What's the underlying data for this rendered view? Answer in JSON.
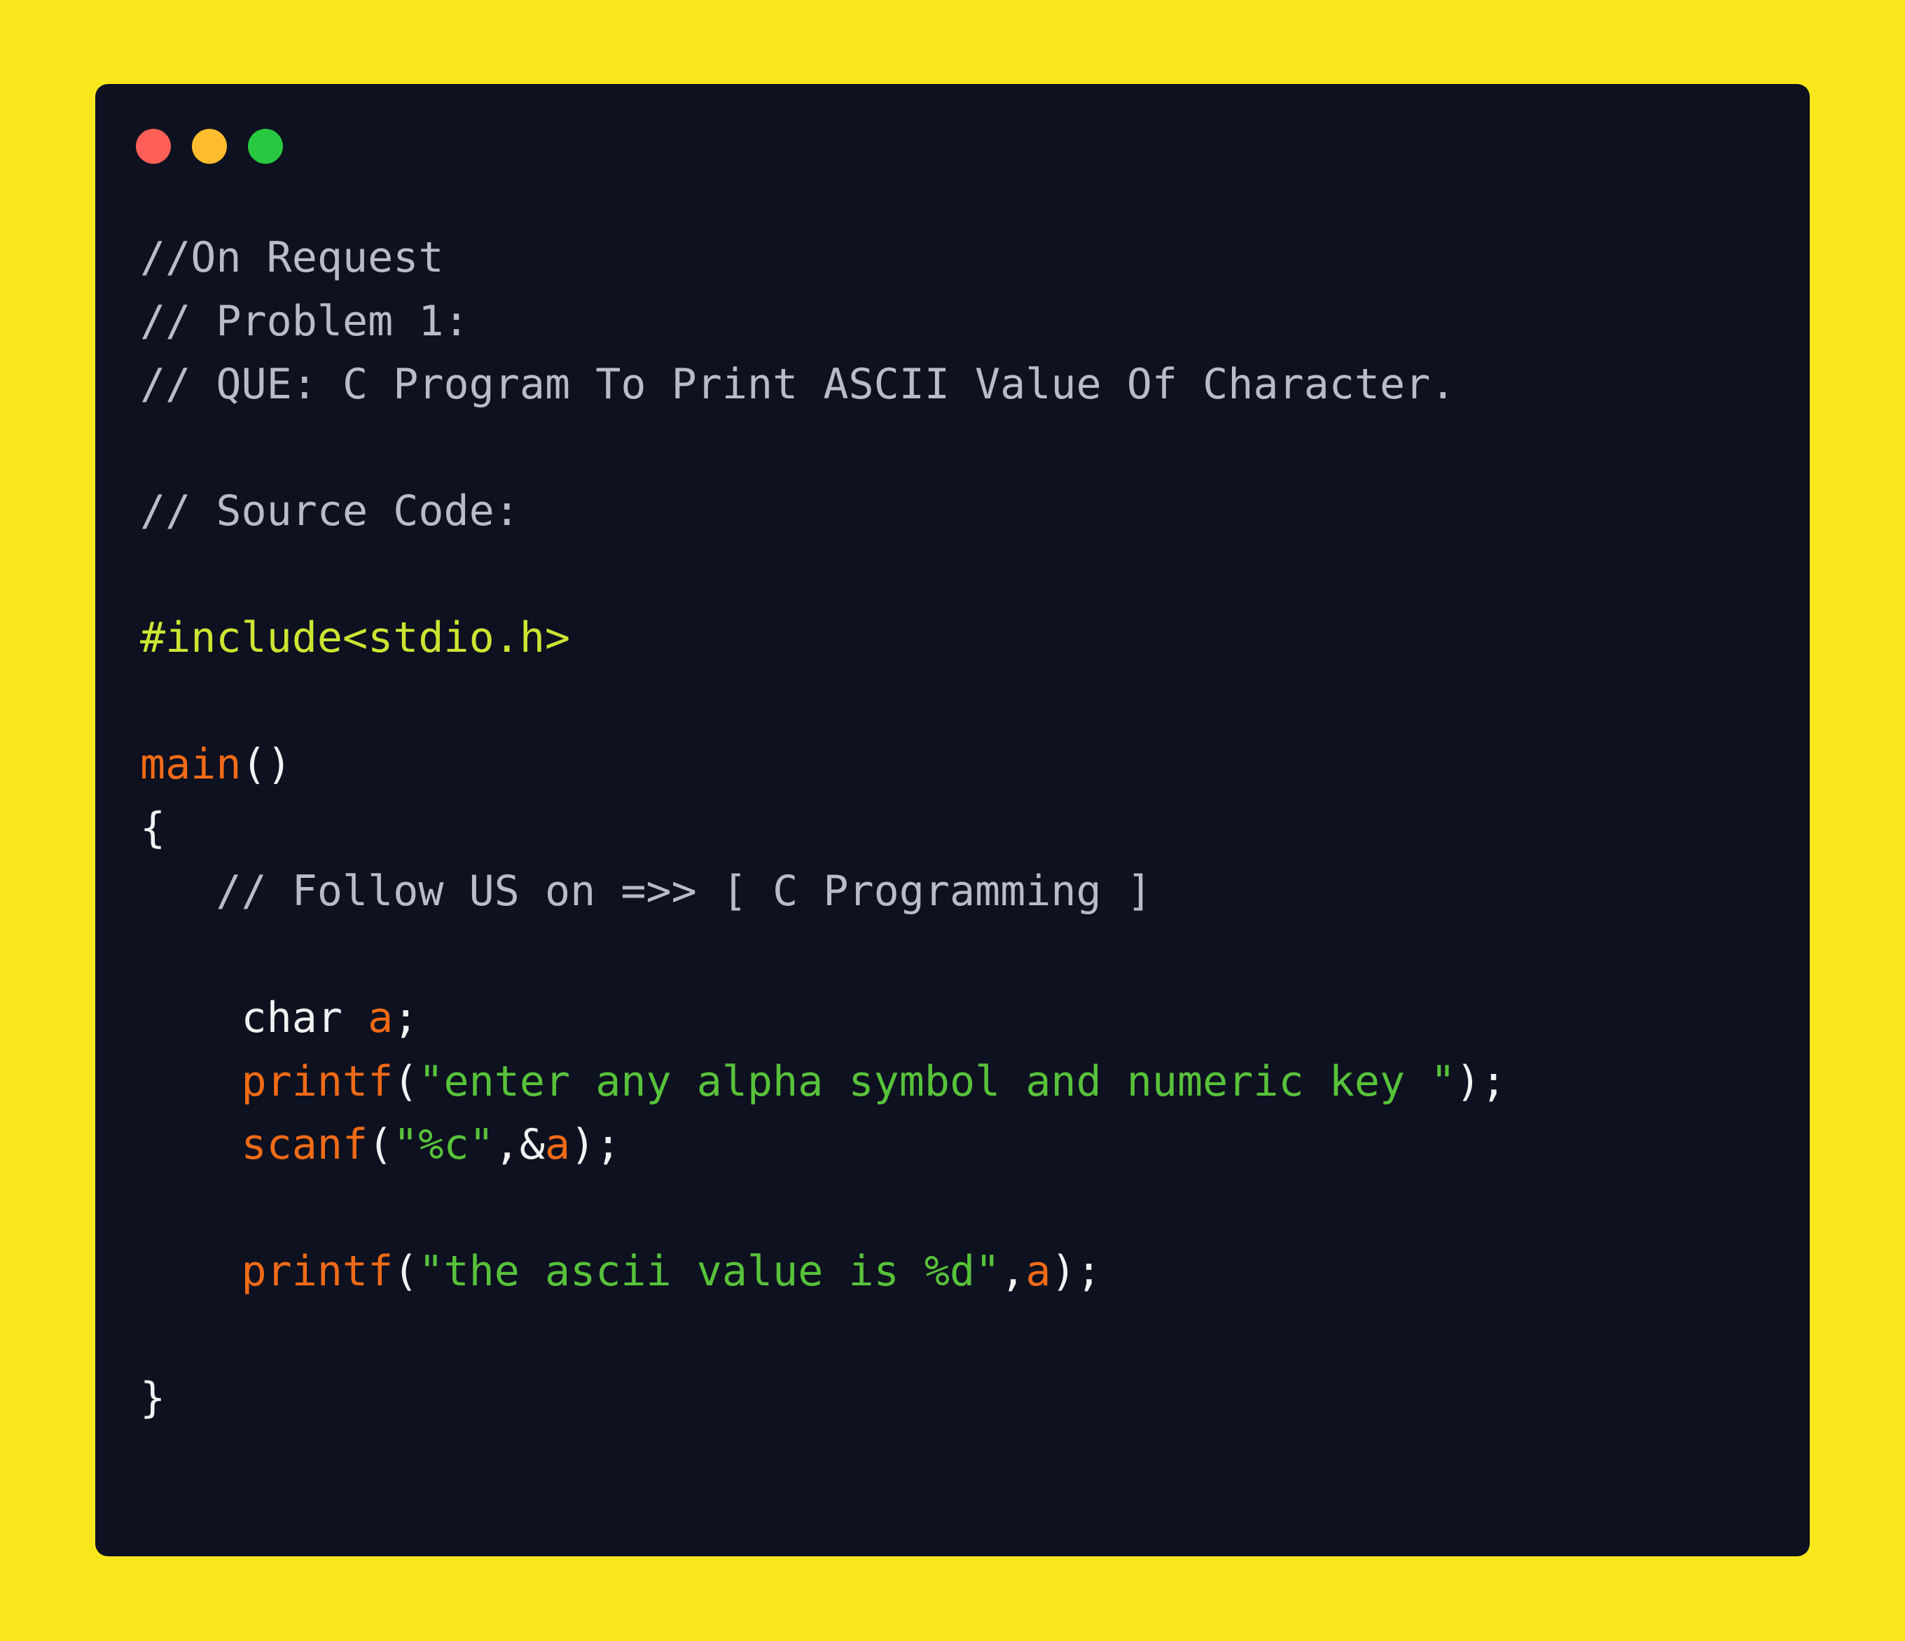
{
  "colors": {
    "background": "#f8e71c",
    "editor_bg": "#0d1120",
    "dot_close": "#ff5f57",
    "dot_minimize": "#febc2e",
    "dot_maximize": "#28c840",
    "comment": "#b9bcc6",
    "preprocessor": "#cde532",
    "function": "#f26b16",
    "string": "#58c23a",
    "plain": "#f2f2f2"
  },
  "window_controls": [
    "close",
    "minimize",
    "maximize"
  ],
  "code_lines": [
    {
      "tokens": [
        {
          "t": "//On Request",
          "k": "comment"
        }
      ]
    },
    {
      "tokens": [
        {
          "t": "// Problem 1:",
          "k": "comment"
        }
      ]
    },
    {
      "tokens": [
        {
          "t": "// QUE: C Program To Print ASCII Value Of Character.",
          "k": "comment"
        }
      ]
    },
    {
      "tokens": []
    },
    {
      "tokens": [
        {
          "t": "// Source Code:",
          "k": "comment"
        }
      ]
    },
    {
      "tokens": []
    },
    {
      "tokens": [
        {
          "t": "#include<stdio.h>",
          "k": "pre"
        }
      ]
    },
    {
      "tokens": []
    },
    {
      "tokens": [
        {
          "t": "main",
          "k": "fn"
        },
        {
          "t": "()",
          "k": "plain"
        }
      ]
    },
    {
      "tokens": [
        {
          "t": "{",
          "k": "plain"
        }
      ]
    },
    {
      "tokens": [
        {
          "t": "   // Follow US on =>> [ C Programming ]",
          "k": "comment"
        }
      ]
    },
    {
      "tokens": []
    },
    {
      "tokens": [
        {
          "t": "    char ",
          "k": "plain"
        },
        {
          "t": "a",
          "k": "var"
        },
        {
          "t": ";",
          "k": "plain"
        }
      ]
    },
    {
      "tokens": [
        {
          "t": "    printf",
          "k": "fn"
        },
        {
          "t": "(",
          "k": "plain"
        },
        {
          "t": "\"enter any alpha symbol and numeric key \"",
          "k": "str"
        },
        {
          "t": ");",
          "k": "plain"
        }
      ]
    },
    {
      "tokens": [
        {
          "t": "    scanf",
          "k": "fn"
        },
        {
          "t": "(",
          "k": "plain"
        },
        {
          "t": "\"%c\"",
          "k": "str"
        },
        {
          "t": ",&",
          "k": "plain"
        },
        {
          "t": "a",
          "k": "var"
        },
        {
          "t": ");",
          "k": "plain"
        }
      ]
    },
    {
      "tokens": []
    },
    {
      "tokens": [
        {
          "t": "    printf",
          "k": "fn"
        },
        {
          "t": "(",
          "k": "plain"
        },
        {
          "t": "\"the ascii value is %d\"",
          "k": "str"
        },
        {
          "t": ",",
          "k": "plain"
        },
        {
          "t": "a",
          "k": "var"
        },
        {
          "t": ");",
          "k": "plain"
        }
      ]
    },
    {
      "tokens": []
    },
    {
      "tokens": [
        {
          "t": "}",
          "k": "plain"
        }
      ]
    }
  ]
}
